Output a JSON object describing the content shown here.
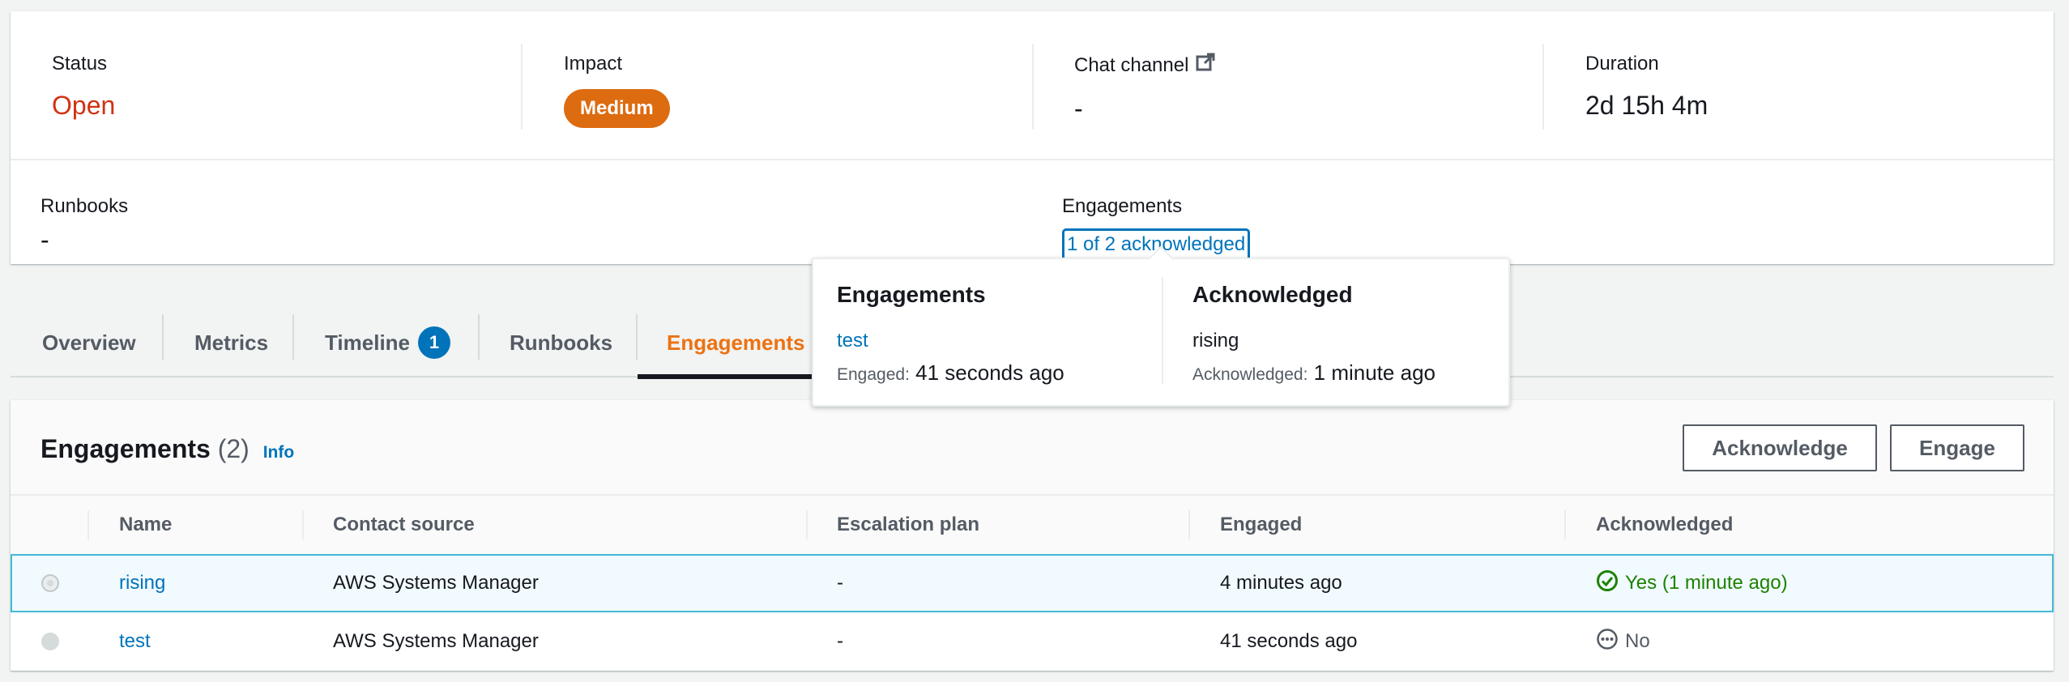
{
  "summary": {
    "status": {
      "label": "Status",
      "value": "Open"
    },
    "impact": {
      "label": "Impact",
      "value": "Medium"
    },
    "chat_channel": {
      "label": "Chat channel",
      "value": "-"
    },
    "duration": {
      "label": "Duration",
      "value": "2d 15h 4m"
    },
    "runbooks": {
      "label": "Runbooks",
      "value": "-"
    },
    "engagements": {
      "label": "Engagements",
      "link": "1 of 2 acknowledged"
    }
  },
  "tabs": [
    {
      "label": "Overview"
    },
    {
      "label": "Metrics"
    },
    {
      "label": "Timeline",
      "badge": "1"
    },
    {
      "label": "Runbooks"
    },
    {
      "label": "Engagements",
      "active": true
    }
  ],
  "popover": {
    "engagements": {
      "title": "Engagements",
      "name": "test",
      "meta_label": "Engaged:",
      "meta_value": "41 seconds ago"
    },
    "acknowledged": {
      "title": "Acknowledged",
      "name": "rising",
      "meta_label": "Acknowledged:",
      "meta_value": "1 minute ago"
    }
  },
  "table": {
    "title": "Engagements",
    "count": "(2)",
    "info": "Info",
    "buttons": {
      "acknowledge": "Acknowledge",
      "engage": "Engage"
    },
    "columns": [
      "Name",
      "Contact source",
      "Escalation plan",
      "Engaged",
      "Acknowledged"
    ],
    "rows": [
      {
        "name": "rising",
        "contact_source": "AWS Systems Manager",
        "escalation_plan": "-",
        "engaged": "4 minutes ago",
        "acknowledged": "Yes (1 minute ago)",
        "ack_state": "yes",
        "selected": true
      },
      {
        "name": "test",
        "contact_source": "AWS Systems Manager",
        "escalation_plan": "-",
        "engaged": "41 seconds ago",
        "acknowledged": "No",
        "ack_state": "no",
        "selected": false
      }
    ]
  },
  "colors": {
    "status_open": "#d13212",
    "impact_medium": "#dd6b10",
    "link": "#0073bb",
    "active_tab": "#ec7211",
    "success": "#1d8102"
  }
}
